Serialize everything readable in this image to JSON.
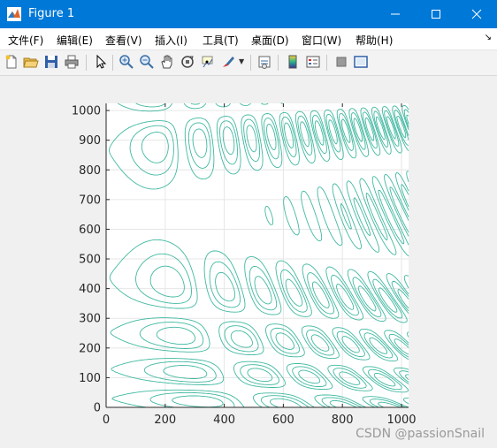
{
  "window": {
    "title": "Figure 1",
    "colors": {
      "titlebar": "#0078d7",
      "contour": "#3fb8a0"
    }
  },
  "menu": {
    "items": [
      "文件(F)",
      "编辑(E)",
      "查看(V)",
      "插入(I)",
      "工具(T)",
      "桌面(D)",
      "窗口(W)",
      "帮助(H)"
    ],
    "overflow_icon": "double-chevron-icon"
  },
  "toolbar": {
    "buttons": [
      "new-figure-icon",
      "open-file-icon",
      "save-icon",
      "print-icon",
      "pointer-icon",
      "zoom-in-icon",
      "zoom-out-icon",
      "pan-icon",
      "rotate-3d-icon",
      "data-cursor-icon",
      "brush-icon",
      "link-plot-icon",
      "colorbar-icon",
      "legend-icon",
      "hide-plot-tools-icon",
      "show-plot-tools-icon"
    ]
  },
  "chart_data": {
    "type": "contour",
    "title": "",
    "xlabel": "",
    "ylabel": "",
    "xlim": [
      0,
      1024
    ],
    "ylim": [
      0,
      1024
    ],
    "xticks": [
      0,
      200,
      400,
      600,
      800,
      1000
    ],
    "yticks": [
      0,
      100,
      200,
      300,
      400,
      500,
      600,
      700,
      800,
      900,
      1000
    ],
    "grid": true,
    "color": "#3fb8a0"
  },
  "watermark": "CSDN @passionSnail"
}
